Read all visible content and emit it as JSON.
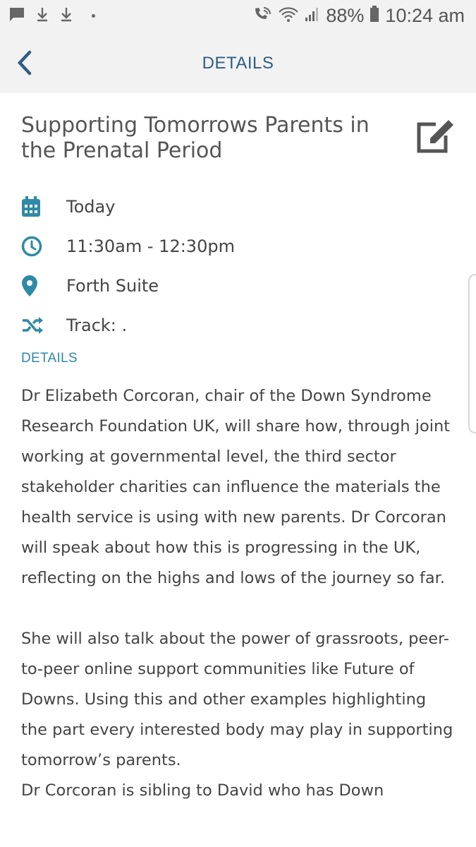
{
  "status_bar": {
    "battery": "88%",
    "time": "10:24 am"
  },
  "header": {
    "title": "DETAILS"
  },
  "session": {
    "title": "Supporting Tomorrows Parents in the Prenatal Period",
    "date": "Today",
    "time": "11:30am - 12:30pm",
    "location": "Forth Suite",
    "track": "Track: ."
  },
  "details": {
    "label": "DETAILS",
    "paragraphs": [
      "Dr Elizabeth Corcoran, chair of the Down Syndrome Research Foundation UK, will share how, through joint working at governmental level, the third sector stakeholder charities can influence the materials the health service is using with new parents. Dr Corcoran will speak about how this is progressing in the UK, reflecting on the highs and lows of the journey so far.",
      "She will also talk about the power of grassroots, peer-to-peer online support communities like Future of Downs. Using this and other examples highlighting the part every interested body may play in supporting tomorrow’s parents.",
      "Dr Corcoran is sibling to David who has Down"
    ]
  },
  "colors": {
    "accent": "#2f8aa5",
    "header_title": "#2d5d86",
    "header_bg": "#f2f2f2"
  },
  "icons": {
    "back": "chevron-left-icon",
    "edit": "edit-icon",
    "date": "calendar-icon",
    "time": "clock-icon",
    "location": "map-pin-icon",
    "track": "shuffle-icon"
  }
}
